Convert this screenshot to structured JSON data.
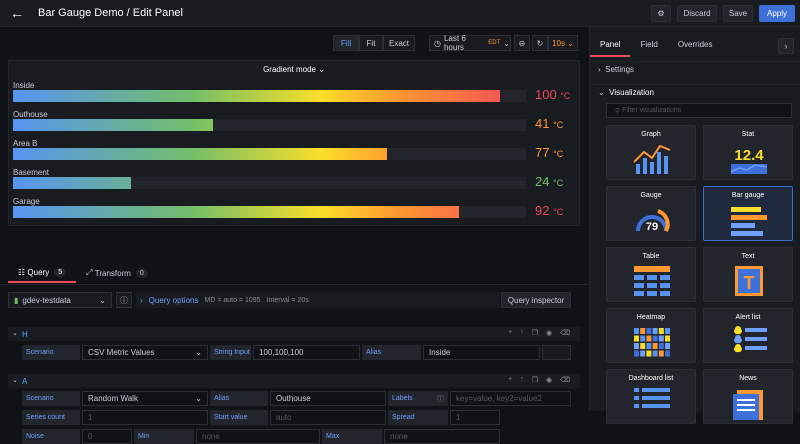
{
  "header": {
    "title": "Bar Gauge Demo / Edit Panel",
    "discard": "Discard",
    "save": "Save",
    "apply": "Apply"
  },
  "toolbar": {
    "fill": "Fill",
    "fit": "Fit",
    "exact": "Exact",
    "time_range": "Last 6 hours",
    "tz": "EDT",
    "refresh": "10s"
  },
  "panel": {
    "title": "Gradient mode",
    "bars": [
      {
        "label": "Inside",
        "value": "100",
        "unit": "°C",
        "fraction": 0.95,
        "color": "#f2495c"
      },
      {
        "label": "Outhouse",
        "value": "41",
        "unit": "°C",
        "fraction": 0.39,
        "color": "#ff9830"
      },
      {
        "label": "Area B",
        "value": "77",
        "unit": "°C",
        "fraction": 0.73,
        "color": "#ff9830"
      },
      {
        "label": "Basement",
        "value": "24",
        "unit": "°C",
        "fraction": 0.23,
        "color": "#73bf69"
      },
      {
        "label": "Garage",
        "value": "92",
        "unit": "°C",
        "fraction": 0.87,
        "color": "#f2495c"
      }
    ]
  },
  "query_tabs": {
    "query": "Query",
    "query_count": "5",
    "transform": "Transform",
    "transform_count": "0"
  },
  "query_bar": {
    "datasource": "gdev-testdata",
    "options": "Query options",
    "md": "MD = auto = 1095",
    "interval": "Interval = 20s",
    "inspector": "Query inspector"
  },
  "query_h": {
    "name": "H",
    "scenario_label": "Scenario",
    "scenario": "CSV Metric Values",
    "string_input_label": "String Input",
    "string_input": "100,100,100",
    "alias_label": "Alias",
    "alias": "Inside"
  },
  "query_a": {
    "name": "A",
    "scenario_label": "Scenario",
    "scenario": "Random Walk",
    "alias_label": "Alias",
    "alias": "Outhouse",
    "labels_label": "Labels",
    "labels_ph": "key=value, key2=value2",
    "series_count_label": "Series count",
    "series_count": "1",
    "start_value_label": "Start value",
    "start_value_ph": "auto",
    "spread_label": "Spread",
    "spread": "1",
    "noise_label": "Noise",
    "noise": "0",
    "min_label": "Min",
    "min_ph": "none",
    "max_label": "Max",
    "max_ph": "none"
  },
  "right": {
    "tabs": [
      "Panel",
      "Field",
      "Overrides"
    ],
    "settings": "Settings",
    "visualization": "Visualization",
    "filter_ph": "Filter visualizations",
    "viz": [
      "Graph",
      "Stat",
      "Gauge",
      "Bar gauge",
      "Table",
      "Text",
      "Heatmap",
      "Alert list",
      "Dashboard list",
      "News"
    ],
    "stat_value": "12.4",
    "gauge_value": "79",
    "text_glyph": "T"
  }
}
